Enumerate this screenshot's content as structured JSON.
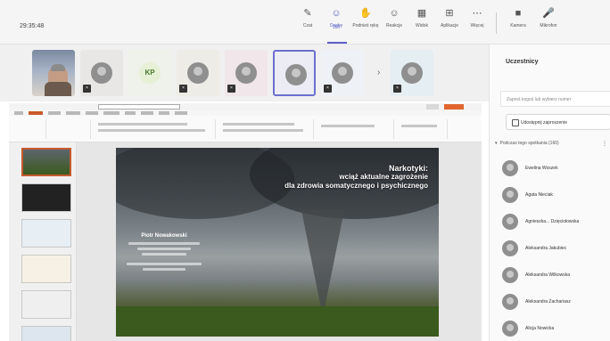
{
  "meeting": {
    "timer": "29:35:48"
  },
  "toolbar": {
    "buttons": [
      {
        "label": "Czat",
        "icon": "chat-icon"
      },
      {
        "label": "Osoby",
        "icon": "people-icon"
      },
      {
        "label": "Podnieś rękę",
        "icon": "raise-hand-icon"
      },
      {
        "label": "Reakcje",
        "icon": "reactions-icon"
      },
      {
        "label": "Widok",
        "icon": "view-icon"
      },
      {
        "label": "Aplikacje",
        "icon": "apps-icon"
      },
      {
        "label": "Więcej",
        "icon": "more-icon"
      },
      {
        "label": "Kamera",
        "icon": "camera-icon"
      },
      {
        "label": "Mikrofon",
        "icon": "microphone-icon"
      }
    ],
    "people_count": "160",
    "accent": "#5b5fc7"
  },
  "participants": {
    "tiles": [
      {
        "type": "camera"
      },
      {
        "type": "avatar"
      },
      {
        "type": "initials",
        "initials": "KP"
      },
      {
        "type": "avatar"
      },
      {
        "type": "avatar"
      },
      {
        "type": "avatar",
        "selected": true
      },
      {
        "type": "avatar"
      },
      {
        "type": "avatar"
      }
    ]
  },
  "slide": {
    "title_line1": "Narkotyki:",
    "title_line2": "wciąż aktualne zagrożenie",
    "title_line3": "dla zdrowia somatycznego i psychicznego",
    "author_name": "Piotr Nowakowski"
  },
  "panel": {
    "title": "Uczestnicy",
    "search_placeholder": "Zaproś kogoś lub wybierz numer",
    "share_button": "Udostępnij zaproszenie",
    "section_label": "Podczas tego spotkania (160)",
    "people": [
      "Ewelina Woszek",
      "Agata Nieciak",
      "Agnieszka... Dzięciołowska",
      "Aleksandra Jakubiec",
      "Aleksandra Wilkowska",
      "Aleksandra Zachariasz",
      "Alicja Nowicka"
    ]
  }
}
